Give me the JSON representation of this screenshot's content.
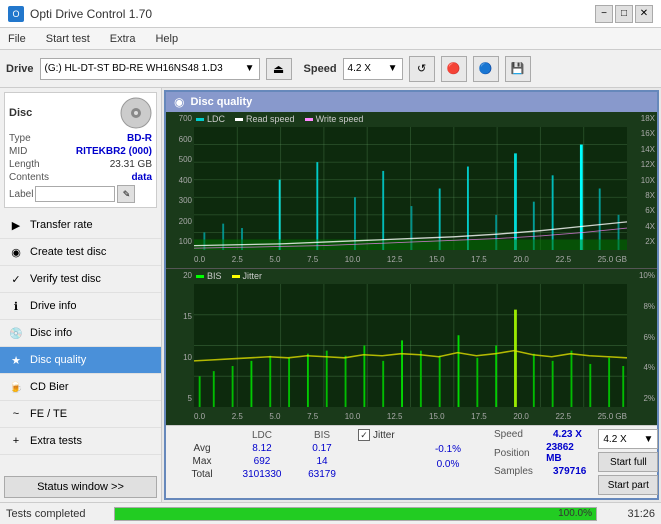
{
  "titlebar": {
    "title": "Opti Drive Control 1.70",
    "icon": "O",
    "min": "−",
    "max": "□",
    "close": "✕"
  },
  "menubar": {
    "items": [
      "File",
      "Start test",
      "Extra",
      "Help"
    ]
  },
  "toolbar": {
    "drive_label": "Drive",
    "drive_value": "(G:) HL-DT-ST BD-RE  WH16NS48 1.D3",
    "speed_label": "Speed",
    "speed_value": "4.2 X"
  },
  "disc": {
    "title": "Disc",
    "type_label": "Type",
    "type_value": "BD-R",
    "mid_label": "MID",
    "mid_value": "RITEKBR2 (000)",
    "length_label": "Length",
    "length_value": "23.31 GB",
    "contents_label": "Contents",
    "contents_value": "data",
    "label_label": "Label"
  },
  "sidebar_items": [
    {
      "id": "transfer-rate",
      "label": "Transfer rate",
      "icon": "▶"
    },
    {
      "id": "create-test-disc",
      "label": "Create test disc",
      "icon": "◉"
    },
    {
      "id": "verify-test-disc",
      "label": "Verify test disc",
      "icon": "✓"
    },
    {
      "id": "drive-info",
      "label": "Drive info",
      "icon": "ℹ"
    },
    {
      "id": "disc-info",
      "label": "Disc info",
      "icon": "💿"
    },
    {
      "id": "disc-quality",
      "label": "Disc quality",
      "icon": "★",
      "active": true
    },
    {
      "id": "cd-bier",
      "label": "CD Bier",
      "icon": "🍺"
    },
    {
      "id": "fe-te",
      "label": "FE / TE",
      "icon": "~"
    },
    {
      "id": "extra-tests",
      "label": "Extra tests",
      "icon": "+"
    }
  ],
  "status_window_btn": "Status window >>",
  "disc_quality": {
    "title": "Disc quality",
    "legend": {
      "ldc": "LDC",
      "read_speed": "Read speed",
      "write_speed": "Write speed",
      "bis": "BIS",
      "jitter": "Jitter"
    },
    "top_y_labels": [
      "700",
      "600",
      "500",
      "400",
      "300",
      "200",
      "100"
    ],
    "top_y_right_labels": [
      "18X",
      "16X",
      "14X",
      "12X",
      "10X",
      "8X",
      "6X",
      "4X",
      "2X"
    ],
    "x_labels": [
      "0.0",
      "2.5",
      "5.0",
      "7.5",
      "10.0",
      "12.5",
      "15.0",
      "17.5",
      "20.0",
      "22.5",
      "25.0"
    ],
    "x_label_gb": "GB",
    "bottom_y_labels": [
      "20",
      "15",
      "10",
      "5"
    ],
    "bottom_y_right_labels": [
      "10%",
      "8%",
      "6%",
      "4%",
      "2%"
    ],
    "stats": {
      "headers": [
        "",
        "LDC",
        "BIS",
        "",
        "Jitter",
        "Speed",
        ""
      ],
      "avg_label": "Avg",
      "avg_ldc": "8.12",
      "avg_bis": "0.17",
      "avg_jitter": "-0.1%",
      "avg_speed": "4.23 X",
      "max_label": "Max",
      "max_ldc": "692",
      "max_bis": "14",
      "max_jitter": "0.0%",
      "position_label": "Position",
      "position_value": "23862 MB",
      "total_label": "Total",
      "total_ldc": "3101330",
      "total_bis": "63179",
      "samples_label": "Samples",
      "samples_value": "379716",
      "jitter_checked": true,
      "speed_dropdown": "4.2 X",
      "start_full_btn": "Start full",
      "start_part_btn": "Start part"
    }
  },
  "statusbar": {
    "status_text": "Tests completed",
    "progress_pct": 100,
    "progress_label": "100.0%",
    "time": "31:26"
  },
  "colors": {
    "ldc": "#00ffff",
    "read_speed": "#ffffff",
    "write_speed": "#ff66ff",
    "bis": "#00ff00",
    "jitter": "#ffff00",
    "chart_bg": "#0d2a0d",
    "grid": "rgba(100,160,100,0.3)",
    "accent_blue": "#4a90d9",
    "green_bar": "#22cc22"
  }
}
